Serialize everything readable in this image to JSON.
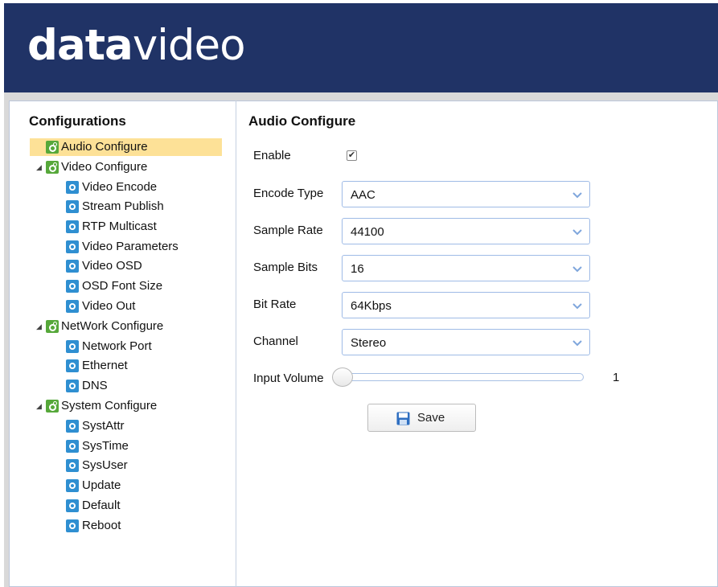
{
  "header": {
    "logo_bold": "data",
    "logo_thin": "video"
  },
  "sidebar": {
    "title": "Configurations",
    "items": [
      {
        "label": "Audio Configure"
      },
      {
        "label": "Video Configure"
      },
      {
        "label": "Video Encode"
      },
      {
        "label": "Stream Publish"
      },
      {
        "label": "RTP Multicast"
      },
      {
        "label": "Video Parameters"
      },
      {
        "label": "Video OSD"
      },
      {
        "label": "OSD Font Size"
      },
      {
        "label": "Video Out"
      },
      {
        "label": "NetWork Configure"
      },
      {
        "label": "Network Port"
      },
      {
        "label": "Ethernet"
      },
      {
        "label": "DNS"
      },
      {
        "label": "System Configure"
      },
      {
        "label": "SystAttr"
      },
      {
        "label": "SysTime"
      },
      {
        "label": "SysUser"
      },
      {
        "label": "Update"
      },
      {
        "label": "Default"
      },
      {
        "label": "Reboot"
      }
    ]
  },
  "main": {
    "title": "Audio Configure",
    "enable": {
      "label": "Enable",
      "checked": true,
      "mark": "✔"
    },
    "encode_type": {
      "label": "Encode Type",
      "value": "AAC"
    },
    "sample_rate": {
      "label": "Sample Rate",
      "value": "44100"
    },
    "sample_bits": {
      "label": "Sample Bits",
      "value": "16"
    },
    "bit_rate": {
      "label": "Bit Rate",
      "value": "64Kbps"
    },
    "channel": {
      "label": "Channel",
      "value": "Stereo"
    },
    "input_volume": {
      "label": "Input Volume",
      "value": "1"
    },
    "save_label": "Save"
  },
  "colors": {
    "header_bg": "#203366",
    "selected_bg": "#fde197",
    "config_icon": "#56a83a",
    "gear_icon": "#2f8fd1",
    "field_border": "#9fbbe6"
  },
  "icons": {
    "config": "config-gear-icon",
    "item": "gear-icon",
    "expand": "expand-arrow-icon",
    "dropdown": "chevron-down-icon",
    "save": "floppy-disk-icon"
  }
}
